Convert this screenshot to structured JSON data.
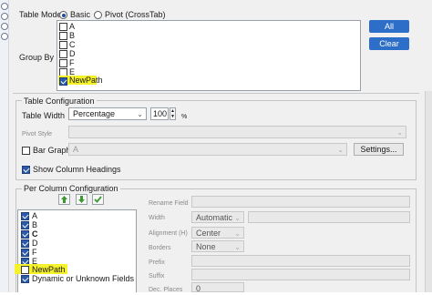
{
  "table_mode": {
    "label": "Table Mode",
    "options": [
      "Basic",
      "Pivot (CrossTab)"
    ],
    "selected": "Basic"
  },
  "group_by": {
    "label": "Group By",
    "items": [
      {
        "label": "A",
        "checked": false
      },
      {
        "label": "B",
        "checked": false
      },
      {
        "label": "C",
        "checked": false
      },
      {
        "label": "D",
        "checked": false
      },
      {
        "label": "F",
        "checked": false
      },
      {
        "label": "E",
        "checked": false
      },
      {
        "label": "NewPath",
        "checked": true
      }
    ],
    "all_label": "All",
    "clear_label": "Clear"
  },
  "table_config": {
    "title": "Table Configuration",
    "table_width_label": "Table Width",
    "table_width_value": "Percentage",
    "table_width_number": "100",
    "table_width_unit": "%",
    "pivot_style_label": "Pivot Style",
    "pivot_style_value": "",
    "bar_graph_label": "Bar Graph",
    "bar_graph_value": "A",
    "settings_label": "Settings...",
    "show_headings_label": "Show Column Headings"
  },
  "per_column": {
    "title": "Per Column Configuration",
    "columns": [
      {
        "label": "A",
        "checked": true,
        "highlight": false
      },
      {
        "label": "B",
        "checked": true,
        "highlight": false
      },
      {
        "label": "C",
        "checked": true,
        "highlight": false
      },
      {
        "label": "D",
        "checked": true,
        "highlight": false
      },
      {
        "label": "F",
        "checked": true,
        "highlight": false
      },
      {
        "label": "E",
        "checked": true,
        "highlight": false
      },
      {
        "label": "NewPath",
        "checked": false,
        "highlight": true
      },
      {
        "label": "Dynamic or Unknown Fields",
        "checked": true,
        "highlight": false
      }
    ],
    "rename_field_label": "Rename Field",
    "width_label": "Width",
    "width_value": "Automatic",
    "alignment_label": "Alignment (H)",
    "alignment_value": "Center",
    "borders_label": "Borders",
    "borders_value": "None",
    "prefix_label": "Prefix",
    "suffix_label": "Suffix",
    "dec_places_label": "Dec. Places",
    "dec_places_value": "0"
  },
  "icons": [
    "gear-icon",
    "info-icon",
    "tag-icon",
    "help-icon",
    "move-up-icon",
    "move-down-icon",
    "check-icon"
  ],
  "colors": {
    "accent": "#2d6ec9",
    "highlight": "#f5f12a",
    "checkbox_checked": "#2c5aa8"
  }
}
